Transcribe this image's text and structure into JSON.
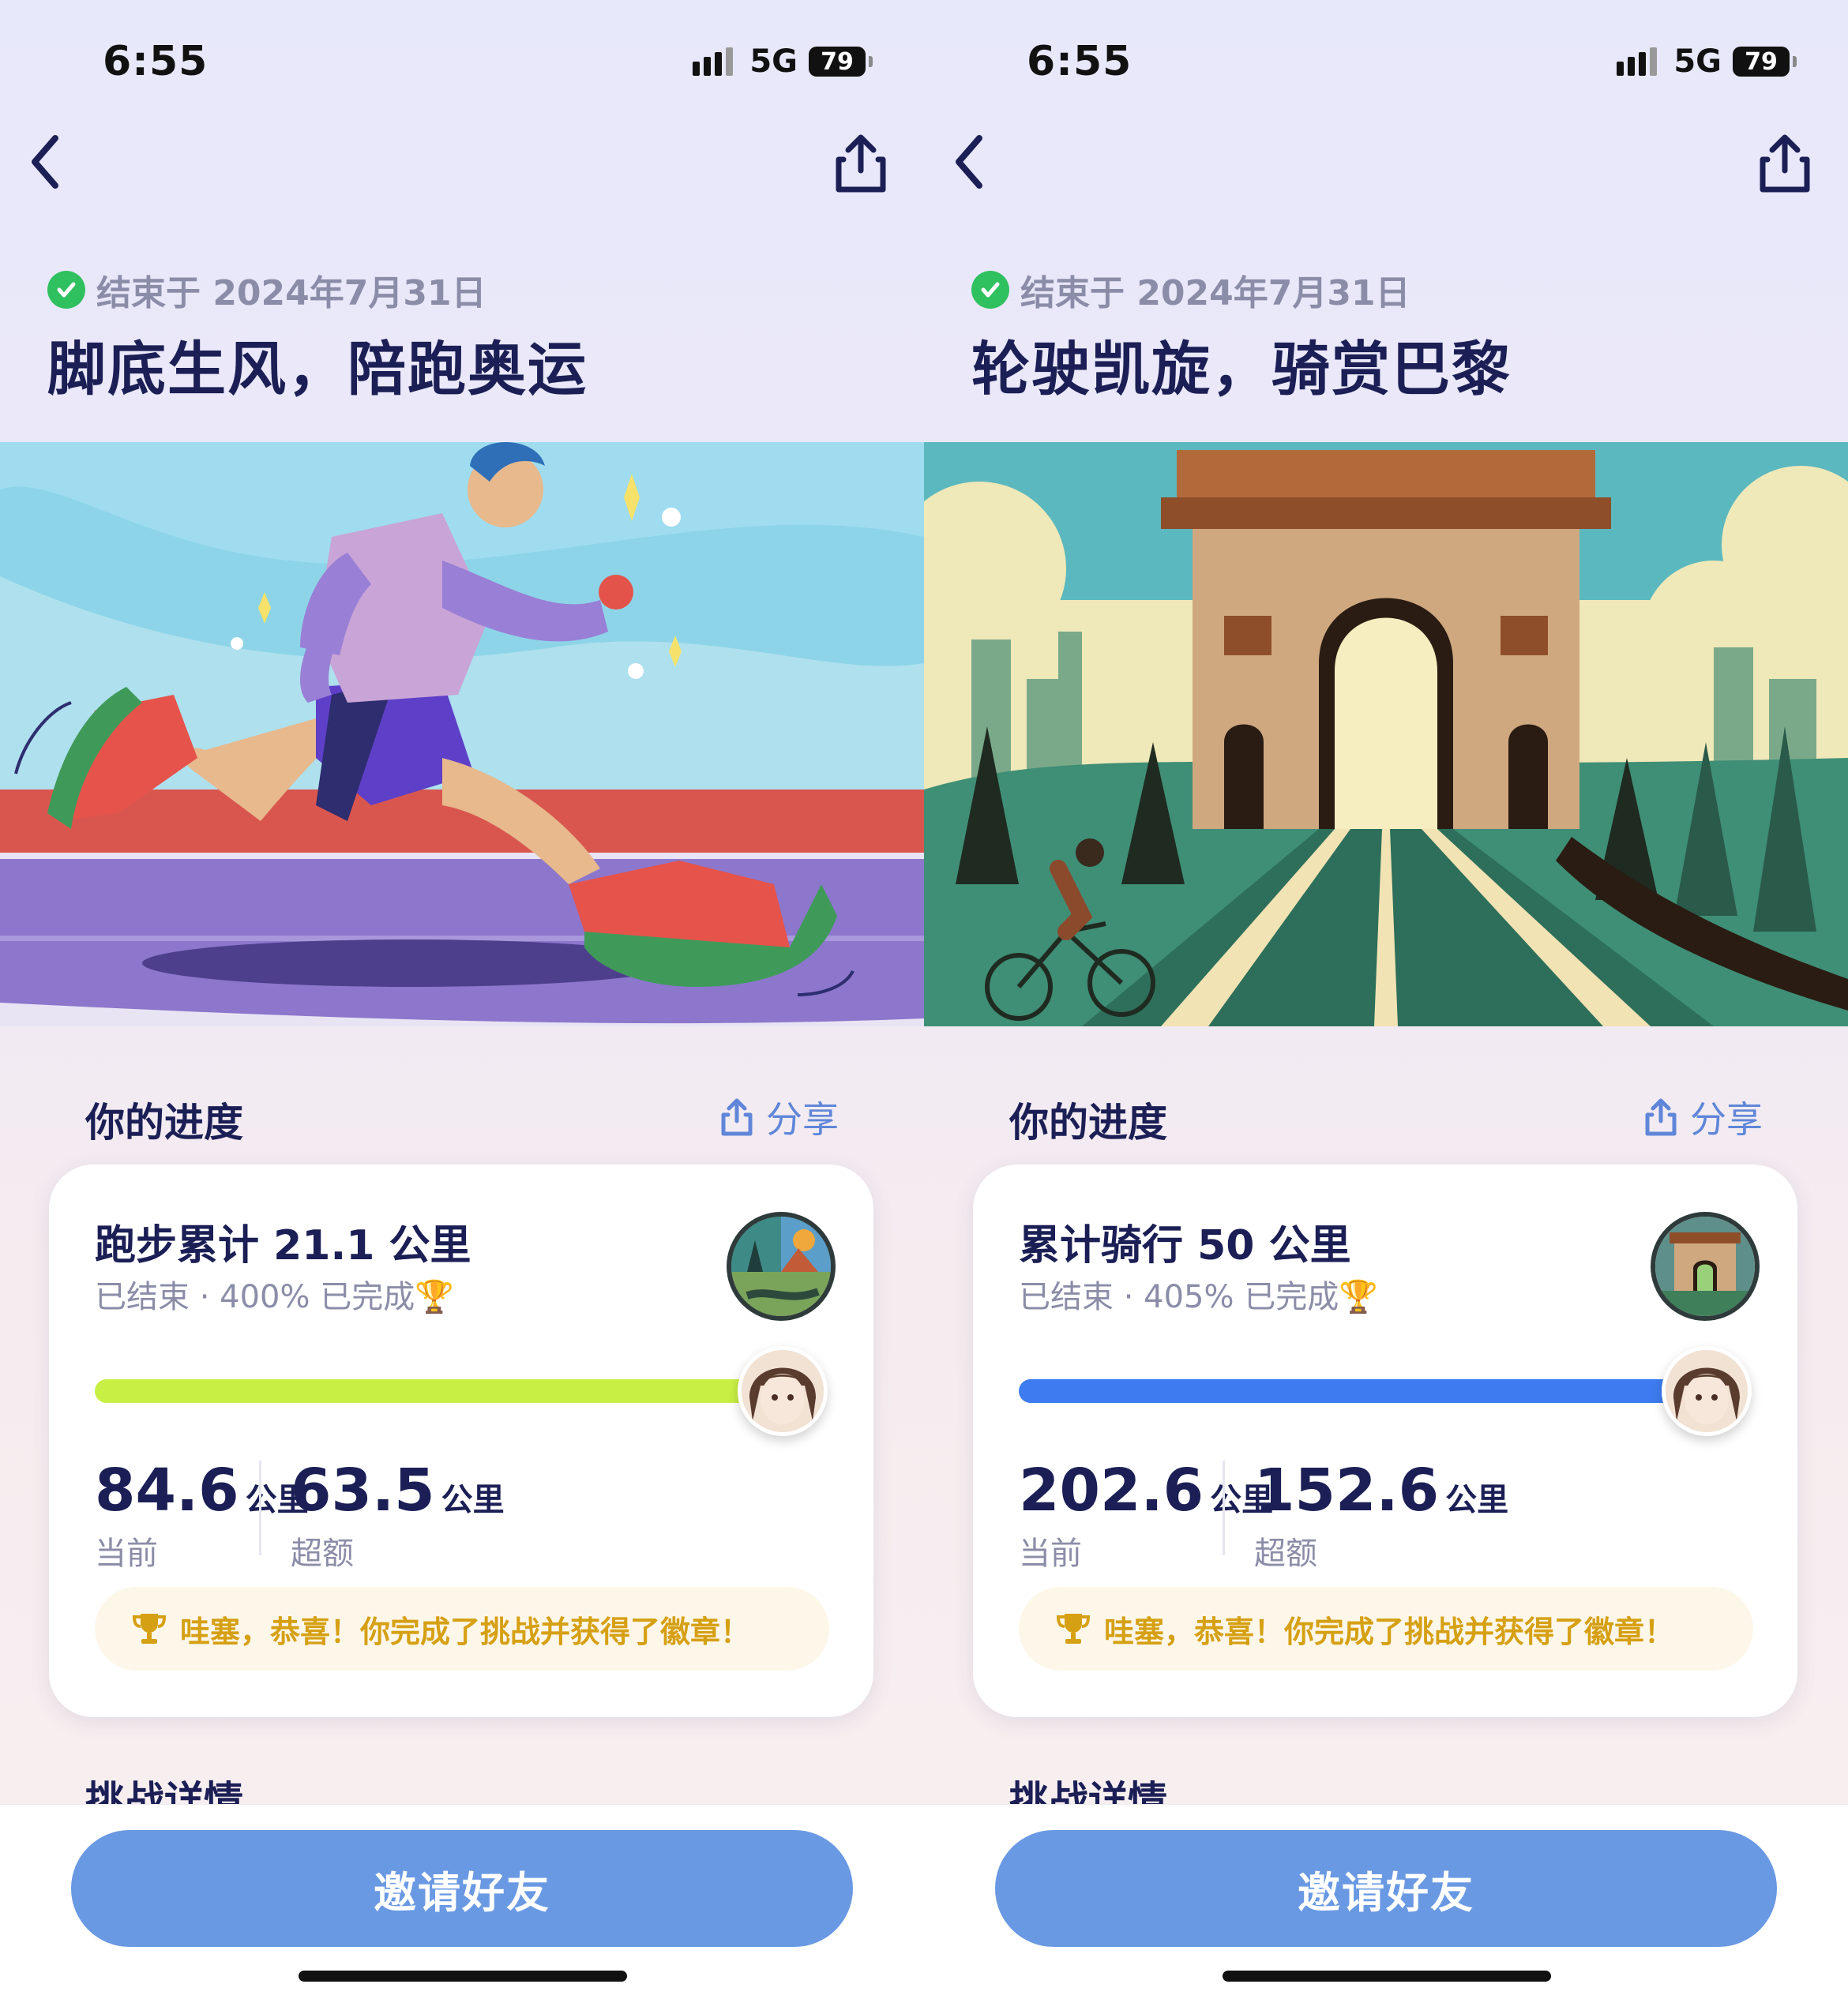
{
  "screens": [
    {
      "status": {
        "time": "6:55",
        "network": "5G",
        "battery": "79"
      },
      "ended_text": "结束于 2024年7月31日",
      "title": "脚底生风，陪跑奥运",
      "section_title": "你的进度",
      "share_label": "分享",
      "card": {
        "title": "跑步累计 21.1 公里",
        "subtitle": "已结束 · 400% 已完成🏆",
        "progress_fraction": 1.0,
        "progress_color": "#c8f044",
        "current_value": "84.6",
        "current_unit": "公里",
        "current_label": "当前",
        "over_value": "63.5",
        "over_unit": "公里",
        "over_label": "超额",
        "congrats": "哇塞，恭喜！你完成了挑战并获得了徽章！"
      },
      "details_title": "挑战详情",
      "invite_label": "邀请好友"
    },
    {
      "status": {
        "time": "6:55",
        "network": "5G",
        "battery": "79"
      },
      "ended_text": "结束于 2024年7月31日",
      "title": "轮驶凯旋，骑赏巴黎",
      "section_title": "你的进度",
      "share_label": "分享",
      "card": {
        "title": "累计骑行 50 公里",
        "subtitle": "已结束 · 405% 已完成🏆",
        "progress_fraction": 1.0,
        "progress_color": "#3d7cf0",
        "current_value": "202.6",
        "current_unit": "公里",
        "current_label": "当前",
        "over_value": "152.6",
        "over_unit": "公里",
        "over_label": "超额",
        "congrats": "哇塞，恭喜！你完成了挑战并获得了徽章！"
      },
      "details_title": "挑战详情",
      "invite_label": "邀请好友"
    }
  ],
  "colors": {
    "accent": "#6a99e3",
    "title": "#1b1f55",
    "success": "#2fc05f",
    "trophy": "#d6a014"
  },
  "icons": [
    "back-chevron-icon",
    "share-icon",
    "check-circle-icon",
    "trophy-icon",
    "challenge-badge-icon",
    "user-avatar"
  ]
}
